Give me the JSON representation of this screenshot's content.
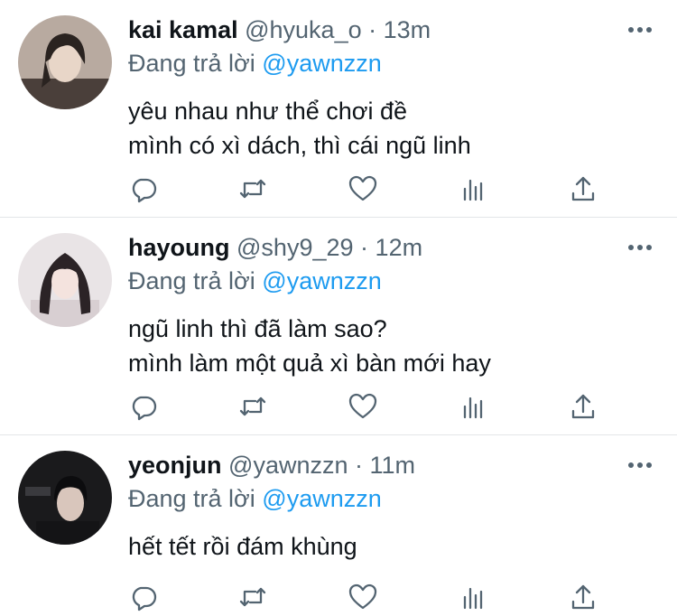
{
  "tweets": [
    {
      "name": "kai kamal",
      "handle": "@hyuka_o",
      "separator": "·",
      "time": "13m",
      "replying_prefix": "Đang trả lời",
      "replying_to": "@yawnzzn",
      "text": "yêu nhau như thể chơi đề\nmình có xì dách, thì cái ngũ linh",
      "avatar_colors": {
        "bg": "#b8aaa0",
        "hair": "#2a2320",
        "skin": "#e8d6c8",
        "shirt": "#4a3f3a"
      }
    },
    {
      "name": "hayoung",
      "handle": "@shy9_29",
      "separator": "·",
      "time": "12m",
      "replying_prefix": "Đang trả lời",
      "replying_to": "@yawnzzn",
      "text": "ngũ linh thì đã làm sao?\nmình làm một quả xì bàn mới hay",
      "avatar_colors": {
        "bg": "#e9e4e6",
        "hair": "#2b2326",
        "skin": "#f4e3de",
        "shirt": "#d8cfd2"
      }
    },
    {
      "name": "yeonjun",
      "handle": "@yawnzzn",
      "separator": "·",
      "time": "11m",
      "replying_prefix": "Đang trả lời",
      "replying_to": "@yawnzzn",
      "text": "hết tết rồi đám khùng",
      "avatar_colors": {
        "bg": "#1a1a1c",
        "hair": "#0c0c0e",
        "skin": "#d9c6bc",
        "shirt": "#141416"
      }
    }
  ],
  "action_icons": [
    "reply-icon",
    "retweet-icon",
    "like-icon",
    "views-icon",
    "share-icon"
  ],
  "colors": {
    "text": "#0f1419",
    "secondary": "#536471",
    "link": "#1d9bf0",
    "divider": "#e3e6e8"
  }
}
